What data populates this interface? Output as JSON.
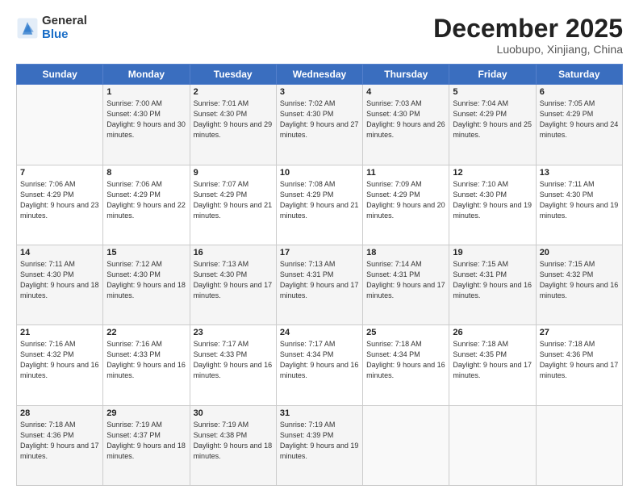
{
  "header": {
    "logo_general": "General",
    "logo_blue": "Blue",
    "month": "December 2025",
    "location": "Luobupo, Xinjiang, China"
  },
  "weekdays": [
    "Sunday",
    "Monday",
    "Tuesday",
    "Wednesday",
    "Thursday",
    "Friday",
    "Saturday"
  ],
  "weeks": [
    [
      {
        "day": "",
        "sunrise": "",
        "sunset": "",
        "daylight": ""
      },
      {
        "day": "1",
        "sunrise": "Sunrise: 7:00 AM",
        "sunset": "Sunset: 4:30 PM",
        "daylight": "Daylight: 9 hours and 30 minutes."
      },
      {
        "day": "2",
        "sunrise": "Sunrise: 7:01 AM",
        "sunset": "Sunset: 4:30 PM",
        "daylight": "Daylight: 9 hours and 29 minutes."
      },
      {
        "day": "3",
        "sunrise": "Sunrise: 7:02 AM",
        "sunset": "Sunset: 4:30 PM",
        "daylight": "Daylight: 9 hours and 27 minutes."
      },
      {
        "day": "4",
        "sunrise": "Sunrise: 7:03 AM",
        "sunset": "Sunset: 4:30 PM",
        "daylight": "Daylight: 9 hours and 26 minutes."
      },
      {
        "day": "5",
        "sunrise": "Sunrise: 7:04 AM",
        "sunset": "Sunset: 4:29 PM",
        "daylight": "Daylight: 9 hours and 25 minutes."
      },
      {
        "day": "6",
        "sunrise": "Sunrise: 7:05 AM",
        "sunset": "Sunset: 4:29 PM",
        "daylight": "Daylight: 9 hours and 24 minutes."
      }
    ],
    [
      {
        "day": "7",
        "sunrise": "Sunrise: 7:06 AM",
        "sunset": "Sunset: 4:29 PM",
        "daylight": "Daylight: 9 hours and 23 minutes."
      },
      {
        "day": "8",
        "sunrise": "Sunrise: 7:06 AM",
        "sunset": "Sunset: 4:29 PM",
        "daylight": "Daylight: 9 hours and 22 minutes."
      },
      {
        "day": "9",
        "sunrise": "Sunrise: 7:07 AM",
        "sunset": "Sunset: 4:29 PM",
        "daylight": "Daylight: 9 hours and 21 minutes."
      },
      {
        "day": "10",
        "sunrise": "Sunrise: 7:08 AM",
        "sunset": "Sunset: 4:29 PM",
        "daylight": "Daylight: 9 hours and 21 minutes."
      },
      {
        "day": "11",
        "sunrise": "Sunrise: 7:09 AM",
        "sunset": "Sunset: 4:29 PM",
        "daylight": "Daylight: 9 hours and 20 minutes."
      },
      {
        "day": "12",
        "sunrise": "Sunrise: 7:10 AM",
        "sunset": "Sunset: 4:30 PM",
        "daylight": "Daylight: 9 hours and 19 minutes."
      },
      {
        "day": "13",
        "sunrise": "Sunrise: 7:11 AM",
        "sunset": "Sunset: 4:30 PM",
        "daylight": "Daylight: 9 hours and 19 minutes."
      }
    ],
    [
      {
        "day": "14",
        "sunrise": "Sunrise: 7:11 AM",
        "sunset": "Sunset: 4:30 PM",
        "daylight": "Daylight: 9 hours and 18 minutes."
      },
      {
        "day": "15",
        "sunrise": "Sunrise: 7:12 AM",
        "sunset": "Sunset: 4:30 PM",
        "daylight": "Daylight: 9 hours and 18 minutes."
      },
      {
        "day": "16",
        "sunrise": "Sunrise: 7:13 AM",
        "sunset": "Sunset: 4:30 PM",
        "daylight": "Daylight: 9 hours and 17 minutes."
      },
      {
        "day": "17",
        "sunrise": "Sunrise: 7:13 AM",
        "sunset": "Sunset: 4:31 PM",
        "daylight": "Daylight: 9 hours and 17 minutes."
      },
      {
        "day": "18",
        "sunrise": "Sunrise: 7:14 AM",
        "sunset": "Sunset: 4:31 PM",
        "daylight": "Daylight: 9 hours and 17 minutes."
      },
      {
        "day": "19",
        "sunrise": "Sunrise: 7:15 AM",
        "sunset": "Sunset: 4:31 PM",
        "daylight": "Daylight: 9 hours and 16 minutes."
      },
      {
        "day": "20",
        "sunrise": "Sunrise: 7:15 AM",
        "sunset": "Sunset: 4:32 PM",
        "daylight": "Daylight: 9 hours and 16 minutes."
      }
    ],
    [
      {
        "day": "21",
        "sunrise": "Sunrise: 7:16 AM",
        "sunset": "Sunset: 4:32 PM",
        "daylight": "Daylight: 9 hours and 16 minutes."
      },
      {
        "day": "22",
        "sunrise": "Sunrise: 7:16 AM",
        "sunset": "Sunset: 4:33 PM",
        "daylight": "Daylight: 9 hours and 16 minutes."
      },
      {
        "day": "23",
        "sunrise": "Sunrise: 7:17 AM",
        "sunset": "Sunset: 4:33 PM",
        "daylight": "Daylight: 9 hours and 16 minutes."
      },
      {
        "day": "24",
        "sunrise": "Sunrise: 7:17 AM",
        "sunset": "Sunset: 4:34 PM",
        "daylight": "Daylight: 9 hours and 16 minutes."
      },
      {
        "day": "25",
        "sunrise": "Sunrise: 7:18 AM",
        "sunset": "Sunset: 4:34 PM",
        "daylight": "Daylight: 9 hours and 16 minutes."
      },
      {
        "day": "26",
        "sunrise": "Sunrise: 7:18 AM",
        "sunset": "Sunset: 4:35 PM",
        "daylight": "Daylight: 9 hours and 17 minutes."
      },
      {
        "day": "27",
        "sunrise": "Sunrise: 7:18 AM",
        "sunset": "Sunset: 4:36 PM",
        "daylight": "Daylight: 9 hours and 17 minutes."
      }
    ],
    [
      {
        "day": "28",
        "sunrise": "Sunrise: 7:18 AM",
        "sunset": "Sunset: 4:36 PM",
        "daylight": "Daylight: 9 hours and 17 minutes."
      },
      {
        "day": "29",
        "sunrise": "Sunrise: 7:19 AM",
        "sunset": "Sunset: 4:37 PM",
        "daylight": "Daylight: 9 hours and 18 minutes."
      },
      {
        "day": "30",
        "sunrise": "Sunrise: 7:19 AM",
        "sunset": "Sunset: 4:38 PM",
        "daylight": "Daylight: 9 hours and 18 minutes."
      },
      {
        "day": "31",
        "sunrise": "Sunrise: 7:19 AM",
        "sunset": "Sunset: 4:39 PM",
        "daylight": "Daylight: 9 hours and 19 minutes."
      },
      {
        "day": "",
        "sunrise": "",
        "sunset": "",
        "daylight": ""
      },
      {
        "day": "",
        "sunrise": "",
        "sunset": "",
        "daylight": ""
      },
      {
        "day": "",
        "sunrise": "",
        "sunset": "",
        "daylight": ""
      }
    ]
  ]
}
